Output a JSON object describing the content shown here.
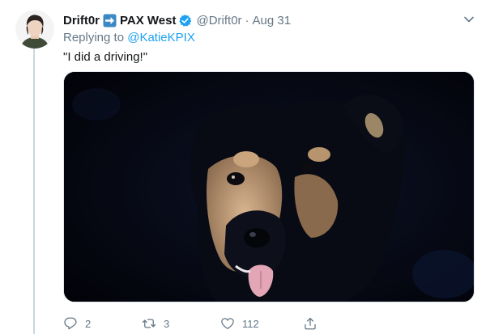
{
  "tweet": {
    "display_name": "Drift0r",
    "display_name_suffix": "PAX West",
    "handle": "@Drift0r",
    "separator": "·",
    "timestamp": "Aug 31",
    "replying_prefix": "Replying to",
    "replying_to": "@KatieKPIX",
    "text": "\"I did a driving!\"",
    "media_alt": "photo of a black and tan dog"
  },
  "actions": {
    "reply_count": "2",
    "retweet_count": "3",
    "like_count": "112"
  },
  "icons": {
    "verified": "verified-badge-icon",
    "emoji": "right-arrow-emoji-icon",
    "caret": "chevron-down-icon",
    "reply": "reply-icon",
    "retweet": "retweet-icon",
    "like": "heart-icon",
    "share": "share-icon"
  },
  "colors": {
    "accent": "#1da1f2",
    "secondary_text": "#657786",
    "primary_text": "#14171a",
    "thread_line": "#ccd6dd"
  }
}
